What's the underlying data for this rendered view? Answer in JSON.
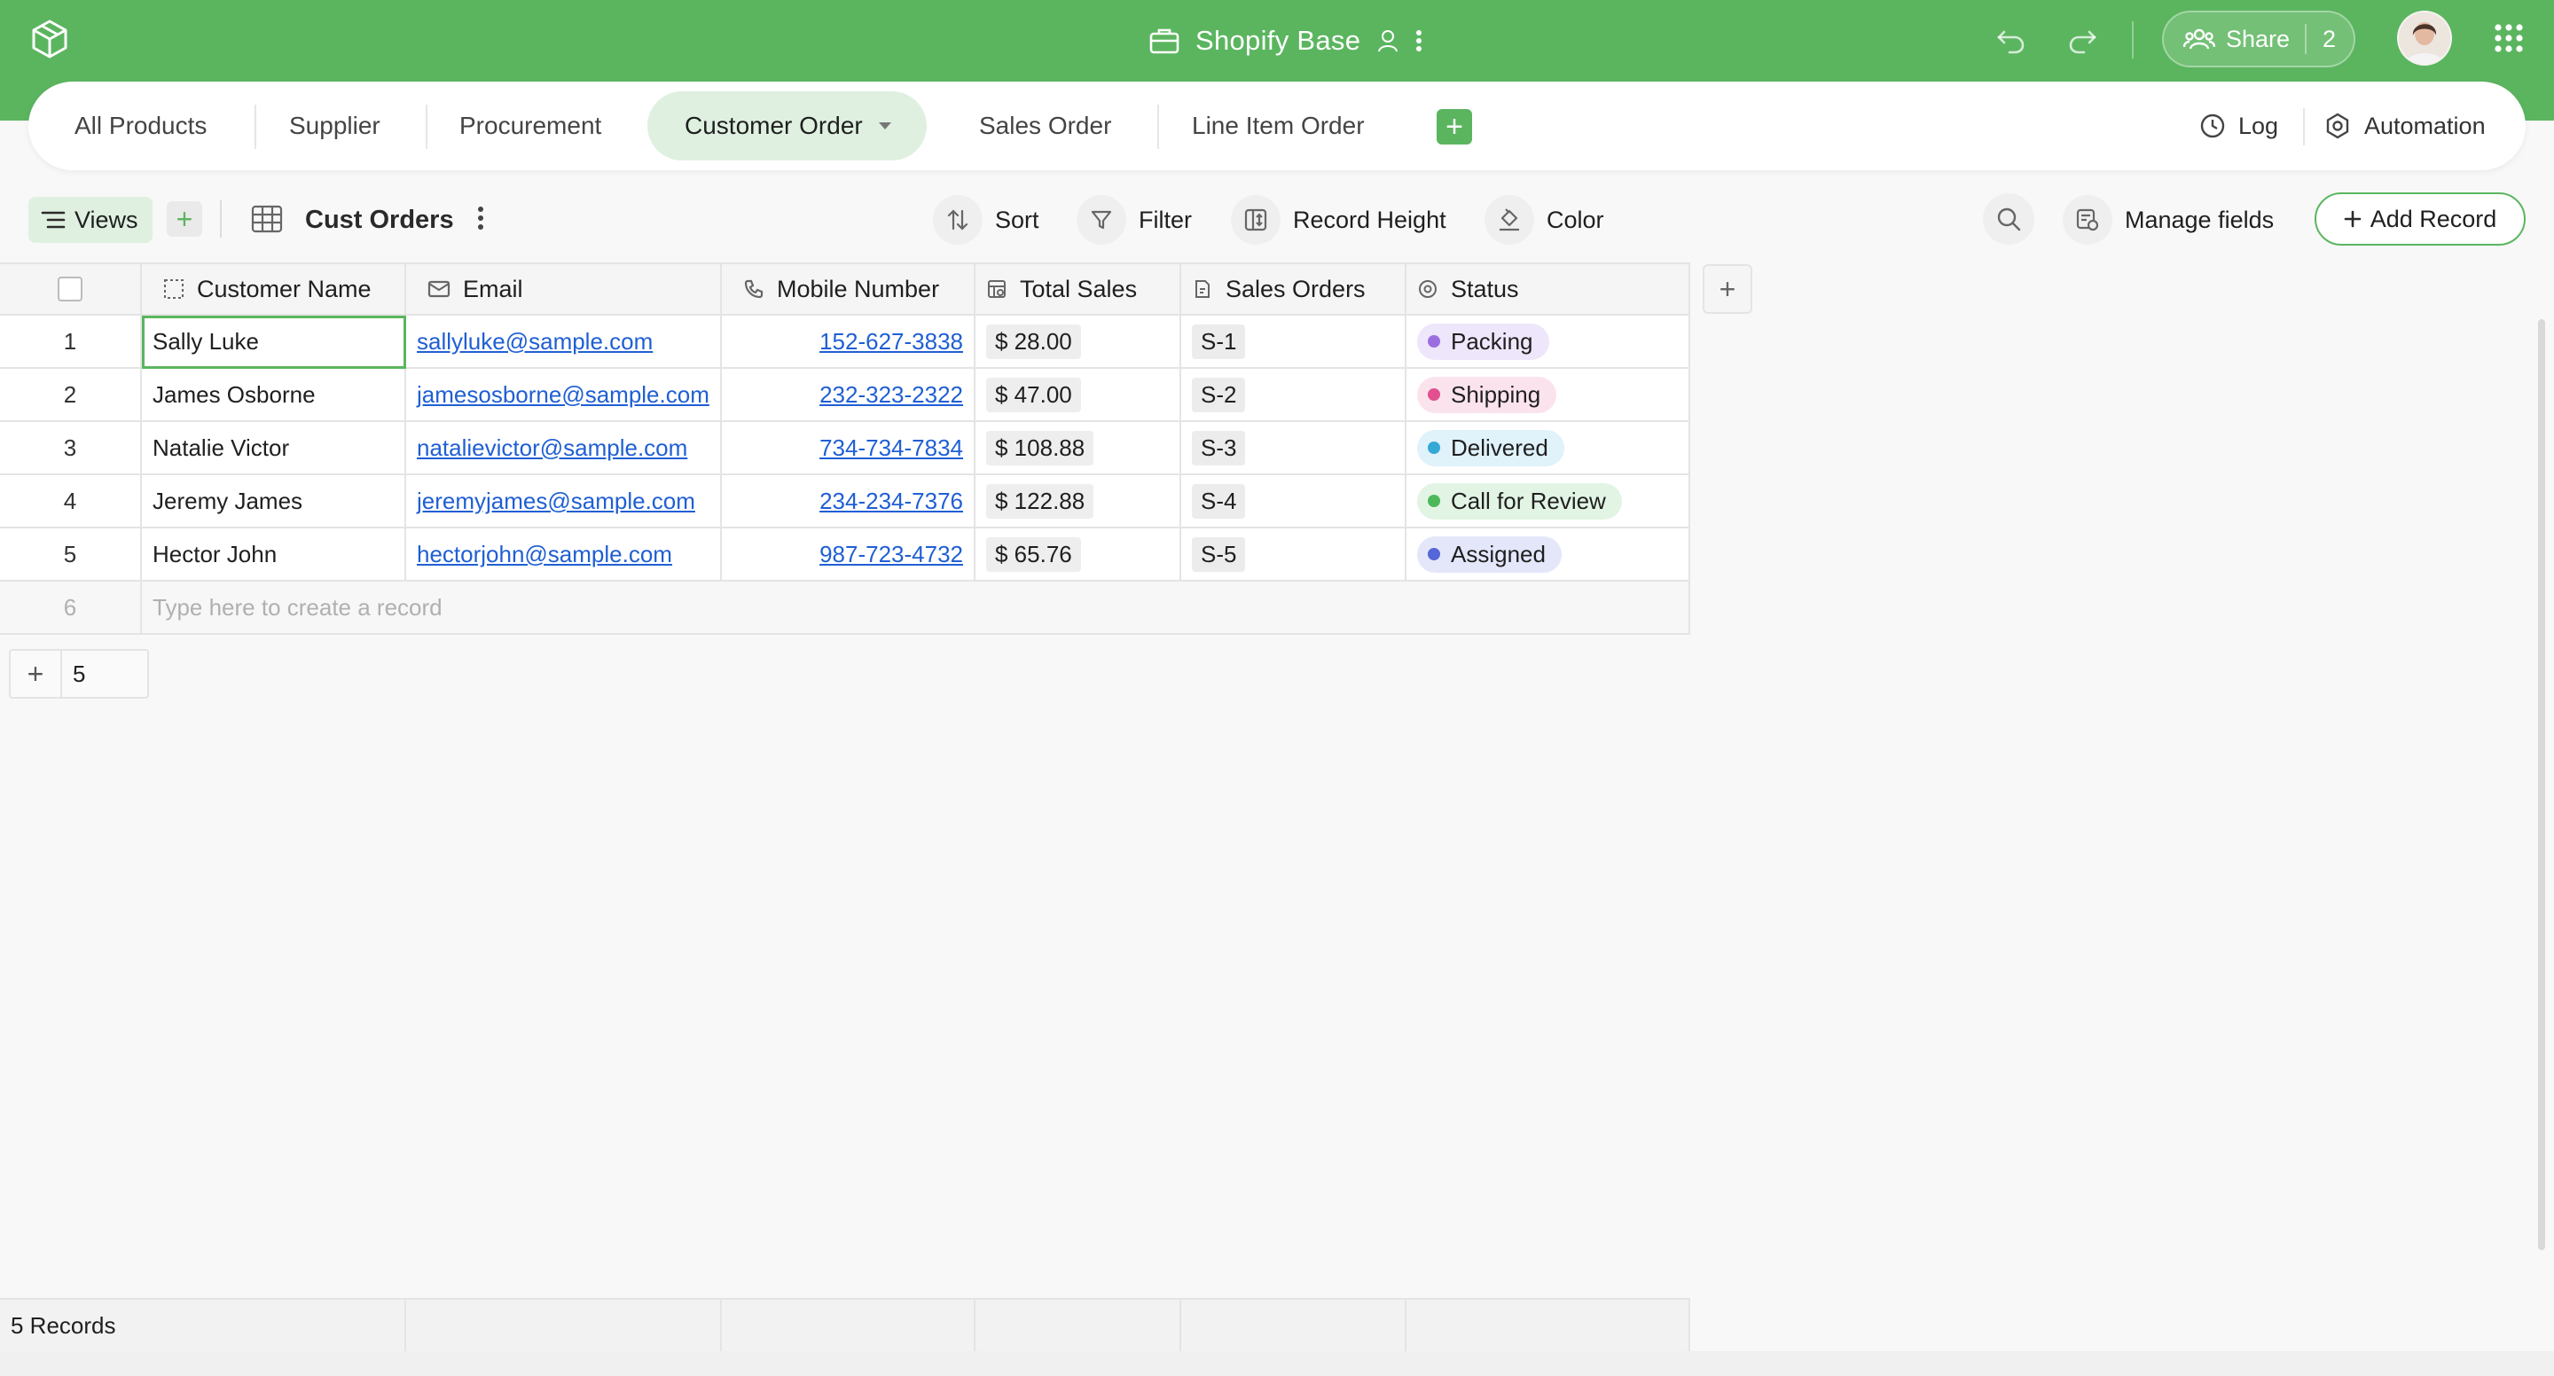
{
  "app": {
    "title": "Shopify Base",
    "share_label": "Share",
    "share_count": "2"
  },
  "tabs": [
    {
      "label": "All Products"
    },
    {
      "label": "Supplier"
    },
    {
      "label": "Procurement"
    },
    {
      "label": "Customer Order"
    },
    {
      "label": "Sales Order"
    },
    {
      "label": "Line Item Order"
    }
  ],
  "tabbar_right": {
    "log": "Log",
    "automation": "Automation"
  },
  "toolbar": {
    "views": "Views",
    "view_name": "Cust Orders",
    "sort": "Sort",
    "filter": "Filter",
    "record_height": "Record Height",
    "color": "Color",
    "manage_fields": "Manage fields",
    "add_record": "Add Record"
  },
  "columns": [
    "Customer Name",
    "Email",
    "Mobile Number",
    "Total Sales",
    "Sales Orders",
    "Status"
  ],
  "rows": [
    {
      "n": "1",
      "name": "Sally Luke",
      "email": "sallyluke@sample.com",
      "mobile": "152-627-3838",
      "total": "$ 28.00",
      "so": "S-1",
      "status": "Packing"
    },
    {
      "n": "2",
      "name": "James Osborne",
      "email": "jamesosborne@sample.com",
      "mobile": "232-323-2322",
      "total": "$ 47.00",
      "so": "S-2",
      "status": "Shipping"
    },
    {
      "n": "3",
      "name": "Natalie Victor",
      "email": "natalievictor@sample.com",
      "mobile": "734-734-7834",
      "total": "$ 108.88",
      "so": "S-3",
      "status": "Delivered"
    },
    {
      "n": "4",
      "name": "Jeremy James",
      "email": "jeremyjames@sample.com",
      "mobile": "234-234-7376",
      "total": "$ 122.88",
      "so": "S-4",
      "status": "Call for Review"
    },
    {
      "n": "5",
      "name": "Hector John",
      "email": "hectorjohn@sample.com",
      "mobile": "987-723-4732",
      "total": "$ 65.76",
      "so": "S-5",
      "status": "Assigned"
    }
  ],
  "status_colors": {
    "Packing": {
      "dot": "#9b6ee0",
      "bg": "#eee6fa"
    },
    "Shipping": {
      "dot": "#e2508f",
      "bg": "#fbe3ee"
    },
    "Delivered": {
      "dot": "#34a8d6",
      "bg": "#e0f2fa"
    },
    "Call for Review": {
      "dot": "#4cb85a",
      "bg": "#e2f4e4"
    },
    "Assigned": {
      "dot": "#5566d8",
      "bg": "#e4e7fa"
    }
  },
  "new_row": {
    "n": "6",
    "placeholder": "Type here to create a record"
  },
  "bottom_count": "5",
  "footer": {
    "records": "5 Records"
  },
  "colors": {
    "brand": "#5bb55f",
    "link": "#1f5fd3"
  }
}
